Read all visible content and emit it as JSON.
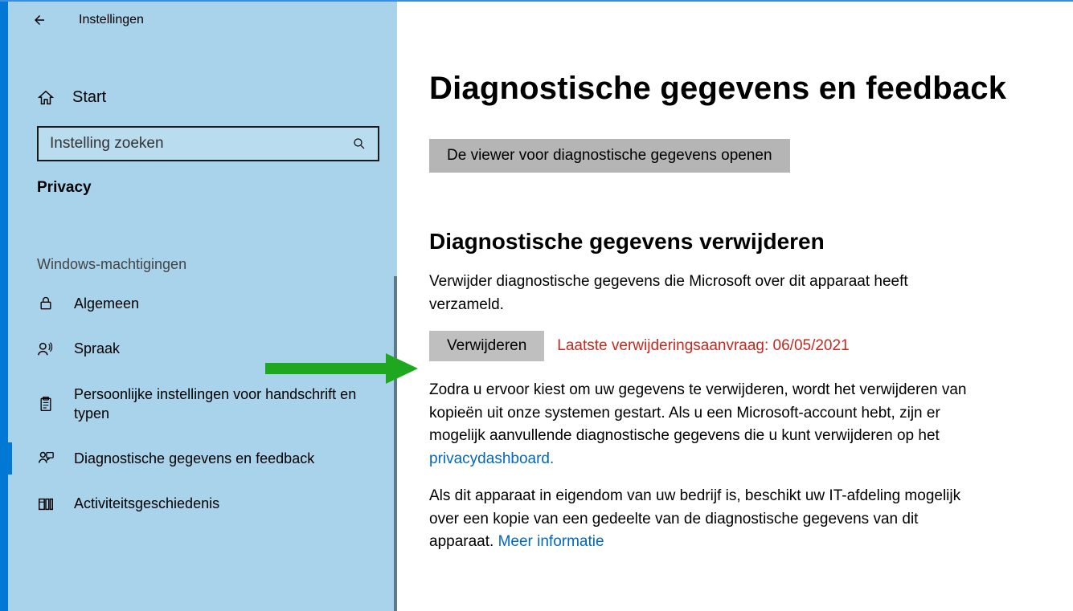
{
  "header": {
    "app_title": "Instellingen",
    "home_label": "Start",
    "search_placeholder": "Instelling zoeken",
    "category": "Privacy"
  },
  "sidebar": {
    "group_header": "Windows-machtigingen",
    "items": [
      {
        "label": "Algemeen",
        "icon": "lock-icon"
      },
      {
        "label": "Spraak",
        "icon": "speech-icon"
      },
      {
        "label": "Persoonlijke instellingen voor handschrift en typen",
        "icon": "clipboard-icon"
      },
      {
        "label": "Diagnostische gegevens en feedback",
        "icon": "feedback-icon",
        "selected": true
      },
      {
        "label": "Activiteitsgeschiedenis",
        "icon": "history-icon"
      }
    ]
  },
  "main": {
    "page_title": "Diagnostische gegevens en feedback",
    "open_viewer_button": "De viewer voor diagnostische gegevens openen",
    "section_title": "Diagnostische gegevens verwijderen",
    "intro_text": "Verwijder diagnostische gegevens die Microsoft over dit apparaat heeft verzameld.",
    "delete_button": "Verwijderen",
    "last_delete_status": "Laatste verwijderingsaanvraag: 06/05/2021",
    "para2_pre": "Zodra u ervoor kiest om uw gegevens te verwijderen, wordt het verwijderen van kopieën uit onze systemen gestart. Als u een Microsoft-account hebt, zijn er mogelijk aanvullende diagnostische gegevens die u kunt verwijderen op het ",
    "para2_link": "privacydashboard.",
    "para3_pre": "Als dit apparaat in eigendom van uw bedrijf is, beschikt uw IT-afdeling mogelijk over een kopie van een gedeelte van de diagnostische gegevens van dit apparaat. ",
    "para3_link": "Meer informatie"
  }
}
